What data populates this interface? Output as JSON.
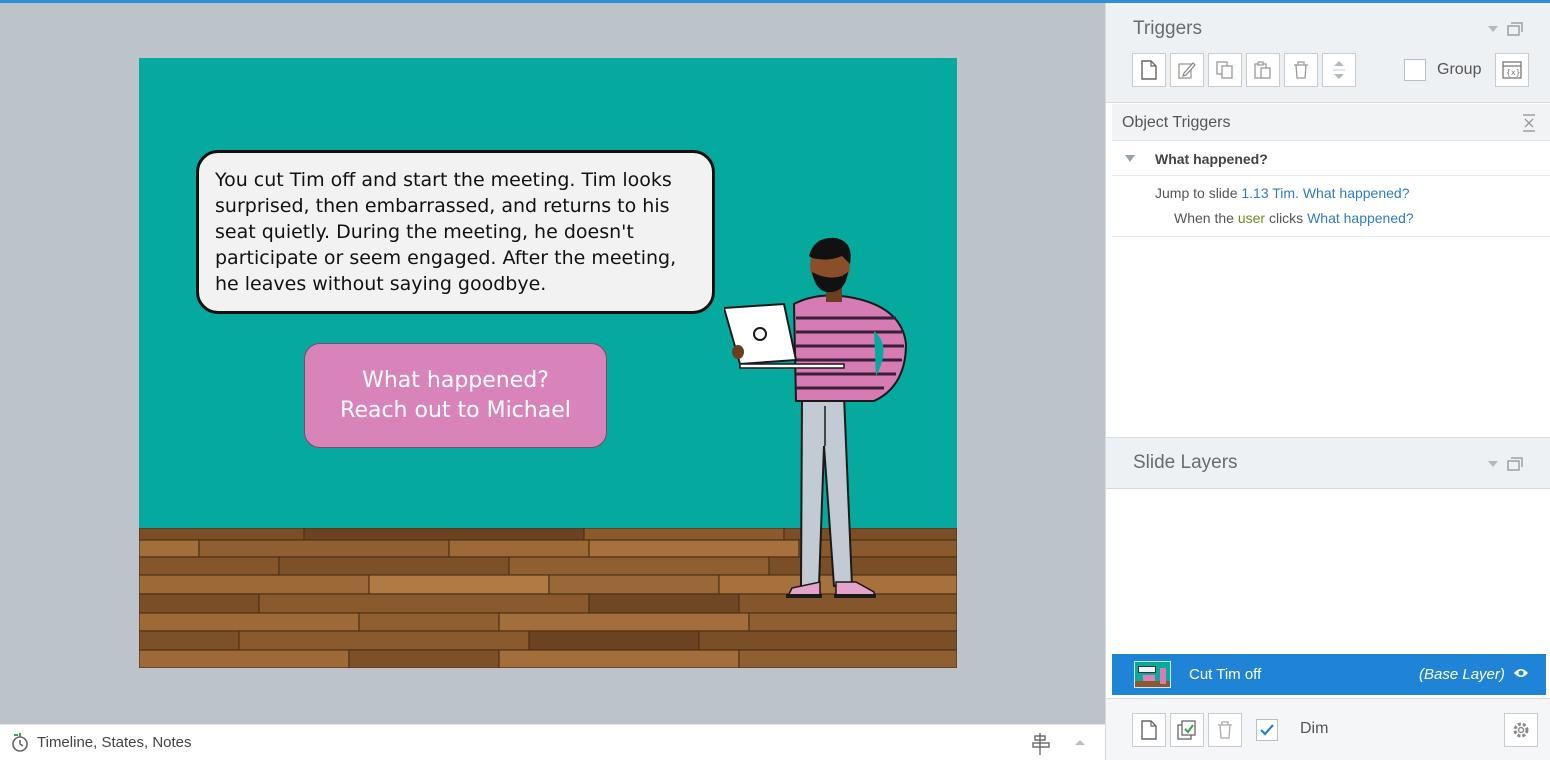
{
  "slide": {
    "speech_text": "You cut Tim off and start the meeting. Tim looks surprised, then embarrassed, and returns to his seat quietly. During the meeting, he doesn't participate or seem engaged. After the meeting, he leaves without saying goodbye.",
    "speech_lines": [
      "You cut Tim off and start the meeting. Tim looks",
      "surprised, then embarrassed, and returns to his",
      "seat quietly. During the meeting, he doesn't",
      "participate or seem engaged. After the meeting,",
      "he leaves without saying goodbye."
    ],
    "cta_line1": "What happened?",
    "cta_line2": "Reach out to Michael",
    "colors": {
      "background": "#06a99d",
      "speech_bg": "#f2f2f2",
      "cta_bg": "#d884bb"
    }
  },
  "statusbar": {
    "label": "Timeline, States, Notes"
  },
  "triggers": {
    "title": "Triggers",
    "toolbar": [
      "new-trigger",
      "edit-trigger",
      "copy-trigger",
      "paste-trigger",
      "delete-trigger",
      "move-up-down"
    ],
    "group_label": "Group",
    "group_checked": false
  },
  "object_triggers": {
    "title": "Object Triggers",
    "object_name": "What happened?",
    "action_text": "Jump to slide ",
    "action_target": "1.13 Tim. What happened?",
    "condition_text": "When the user clicks ",
    "condition_target": "What happened?"
  },
  "slide_layers": {
    "title": "Slide Layers",
    "layers": [
      {
        "name": "Cut Tim off",
        "tag": "(Base Layer)",
        "selected": true
      }
    ],
    "dim_label": "Dim",
    "dim_checked": true
  }
}
